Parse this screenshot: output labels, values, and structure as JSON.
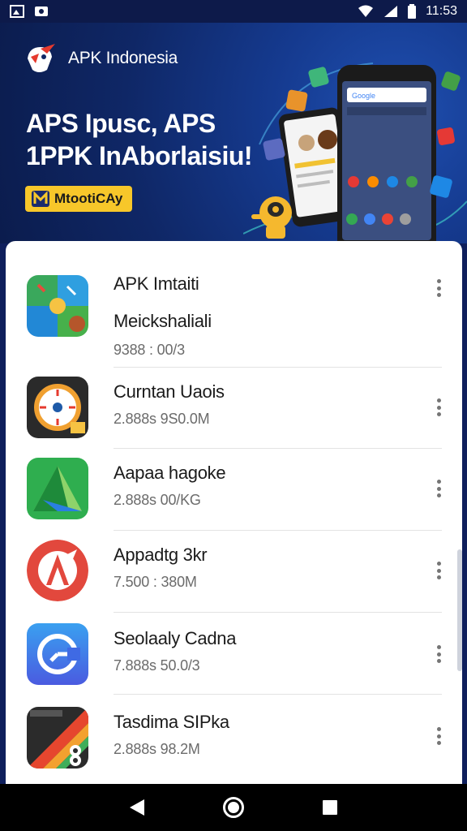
{
  "status_bar": {
    "time": "11:53",
    "left_icons": [
      "gallery-icon",
      "camera-icon"
    ],
    "right_icons": [
      "wifi-icon",
      "signal-icon",
      "battery-icon"
    ]
  },
  "banner": {
    "brand_name": "APK Indonesia",
    "headline_line1": "APS Ipusc, APS",
    "headline_line2": "1PPK InAborlaisiu!",
    "cta_label": "MtootiCAy",
    "accent_color": "#f7c72a"
  },
  "apps": [
    {
      "name": "APK Imtaiti",
      "subtitle": "Meickshaliali",
      "meta": "9388 : 00/3",
      "icon": "colorful-tiles-icon"
    },
    {
      "name": "Curntan Uaois",
      "subtitle": "",
      "meta": "2.888s 9S0.0M",
      "icon": "dial-icon"
    },
    {
      "name": "Aapaa hagoke",
      "subtitle": "",
      "meta": "2.888s 00/KG",
      "icon": "triangle-logo-icon"
    },
    {
      "name": "Appadtg 3kr",
      "subtitle": "",
      "meta": "7.500 : 380M",
      "icon": "red-a-icon"
    },
    {
      "name": "Seolaaly Cadna",
      "subtitle": "",
      "meta": "7.888s 50.0/3",
      "icon": "clock-arrow-icon"
    },
    {
      "name": "Tasdima SIPka",
      "subtitle": "",
      "meta": "2.888s 98.2M",
      "icon": "stripe-8-icon"
    }
  ],
  "nav_bar": {
    "back": "back-icon",
    "home": "home-icon",
    "recents": "recents-icon"
  }
}
